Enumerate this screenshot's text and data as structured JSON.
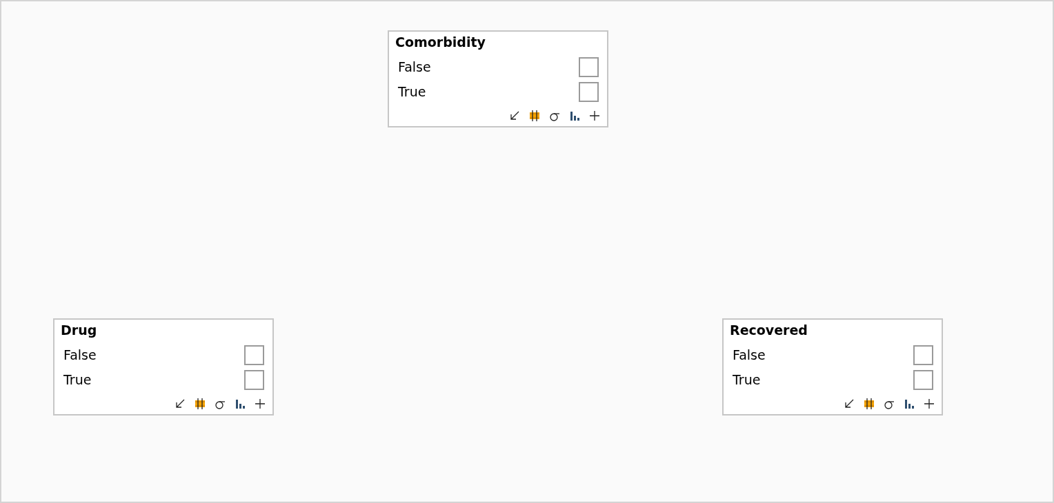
{
  "nodes": [
    {
      "title": "Comorbidity",
      "states": [
        {
          "label": "False",
          "checked": false
        },
        {
          "label": "True",
          "checked": false
        }
      ]
    },
    {
      "title": "Drug",
      "states": [
        {
          "label": "False",
          "checked": false
        },
        {
          "label": "True",
          "checked": false
        }
      ]
    },
    {
      "title": "Recovered",
      "states": [
        {
          "label": "False",
          "checked": false
        },
        {
          "label": "True",
          "checked": false
        }
      ]
    }
  ]
}
